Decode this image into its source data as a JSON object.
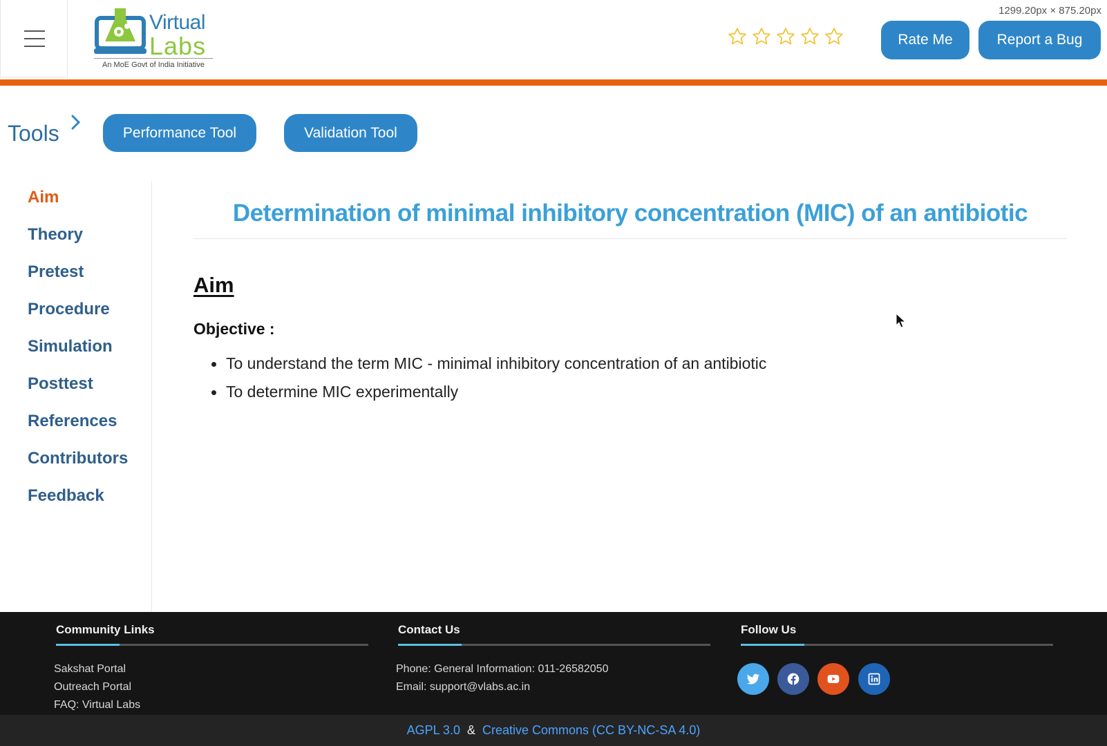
{
  "header": {
    "logo_title_1": "Virtual",
    "logo_title_2": "Labs",
    "logo_tagline": "An MoE Govt of India Initiative",
    "dimensions_label": "1299.20px × 875.20px",
    "rating_stars": 5,
    "rate_button": "Rate Me",
    "bug_button": "Report a Bug"
  },
  "tools": {
    "label": "Tools",
    "buttons": [
      "Performance Tool",
      "Validation Tool"
    ]
  },
  "sidebar": {
    "items": [
      {
        "label": "Aim",
        "active": true
      },
      {
        "label": "Theory",
        "active": false
      },
      {
        "label": "Pretest",
        "active": false
      },
      {
        "label": "Procedure",
        "active": false
      },
      {
        "label": "Simulation",
        "active": false
      },
      {
        "label": "Posttest",
        "active": false
      },
      {
        "label": "References",
        "active": false
      },
      {
        "label": "Contributors",
        "active": false
      },
      {
        "label": "Feedback",
        "active": false
      }
    ]
  },
  "main": {
    "title": "Determination of minimal inhibitory concentration (MIC) of an antibiotic",
    "section_heading": "Aim",
    "objective_label": "Objective :",
    "objectives": [
      "To understand the term MIC - minimal inhibitory concentration of an antibiotic",
      "To determine MIC experimentally"
    ]
  },
  "footer": {
    "community": {
      "heading": "Community Links",
      "links": [
        "Sakshat Portal",
        "Outreach Portal",
        "FAQ: Virtual Labs"
      ]
    },
    "contact": {
      "heading": "Contact Us",
      "phone": "Phone: General Information: 011-26582050",
      "email": "Email: support@vlabs.ac.in"
    },
    "follow": {
      "heading": "Follow Us",
      "icons": [
        "twitter-icon",
        "facebook-icon",
        "youtube-icon",
        "linkedin-icon"
      ]
    },
    "license": {
      "agpl": "AGPL 3.0",
      "amp": "&",
      "cc": "Creative Commons (CC BY-NC-SA 4.0)"
    }
  },
  "colors": {
    "brand_blue": "#2e86c8",
    "accent_orange": "#e8620f",
    "title_blue": "#3ba0d8",
    "star_gold": "#f2c230",
    "twitter": "#4aa8ea",
    "facebook": "#3b5a9a",
    "youtube": "#e2521e",
    "linkedin": "#1f65b6"
  }
}
